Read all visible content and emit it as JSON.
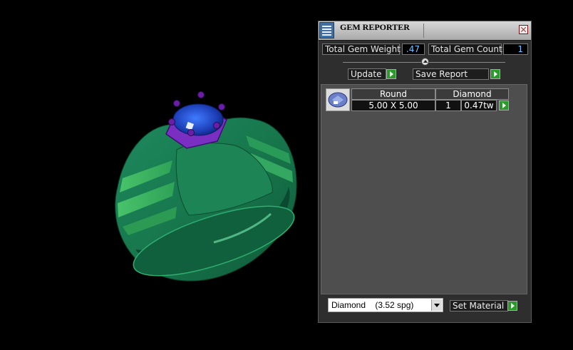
{
  "panel": {
    "title": "GEM REPORTER",
    "total_weight_label": "Total Gem Weight",
    "total_weight_value": ".47",
    "total_count_label": "Total Gem Count",
    "total_count_value": "1",
    "update_label": "Update",
    "save_label": "Save Report",
    "set_material_label": "Set Material"
  },
  "gems": [
    {
      "shape": "Round",
      "material": "Diamond",
      "size": "5.00 X 5.00",
      "qty": "1",
      "weight": "0.47tw"
    }
  ],
  "material_select": {
    "name": "Diamond",
    "sg": "(3.52 spg)"
  },
  "colors": {
    "ring": "#1f8a5c",
    "head": "#7a2fc2",
    "stone": "#1f4fd6"
  }
}
